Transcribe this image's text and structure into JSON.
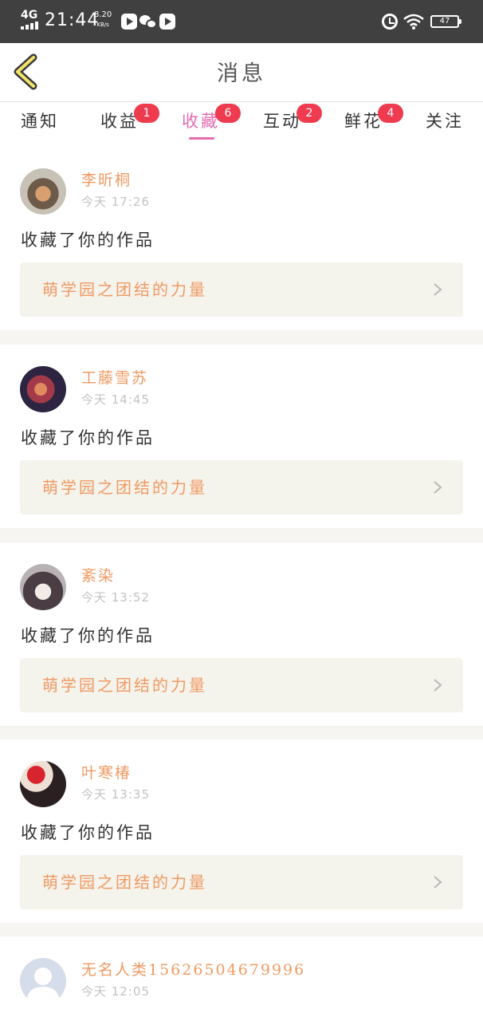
{
  "status_bar": {
    "network": "4G",
    "time": "21:44",
    "speed_value": "8.20",
    "speed_unit": "KB/s",
    "battery": "47"
  },
  "header": {
    "title": "消息"
  },
  "tabs": [
    {
      "label": "通知",
      "badge": ""
    },
    {
      "label": "收益",
      "badge": "1"
    },
    {
      "label": "收藏",
      "badge": "6",
      "active": true
    },
    {
      "label": "互动",
      "badge": "2"
    },
    {
      "label": "鲜花",
      "badge": "4"
    },
    {
      "label": "关注",
      "badge": ""
    }
  ],
  "messages": [
    {
      "user": "李昕桐",
      "time": "今天 17:26",
      "action": "收藏了你的作品",
      "work": "萌学园之团结的力量"
    },
    {
      "user": "工藤雪苏",
      "time": "今天 14:45",
      "action": "收藏了你的作品",
      "work": "萌学园之团结的力量"
    },
    {
      "user": "紊染",
      "time": "今天 13:52",
      "action": "收藏了你的作品",
      "work": "萌学园之团结的力量"
    },
    {
      "user": "叶寒椿",
      "time": "今天 13:35",
      "action": "收藏了你的作品",
      "work": "萌学园之团结的力量"
    },
    {
      "user": "无名人类15626504679996",
      "time": "今天 12:05",
      "action": "",
      "work": ""
    }
  ],
  "colors": {
    "accent_pink": "#e56bb0",
    "name_orange": "#f09a63",
    "badge_red": "#ef3b4f",
    "status_bar": "#404040"
  }
}
